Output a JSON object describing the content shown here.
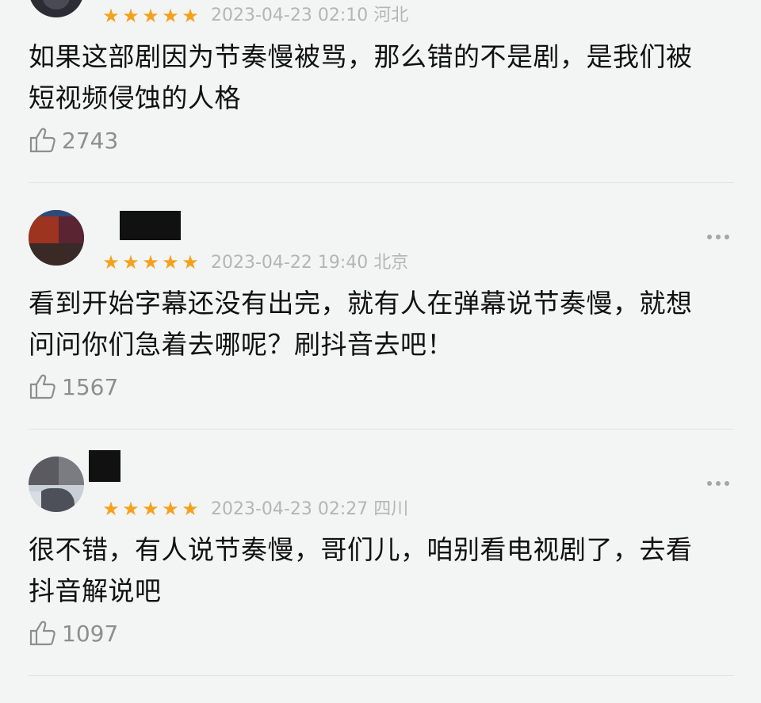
{
  "comments": [
    {
      "rating_icon": "star-icon",
      "stars": 5,
      "date": "2023-04-23 02:10",
      "location": "河北",
      "text_line1": "如果这部剧因为节奏慢被骂，那么错的不是剧，是我们被",
      "text_line2": "短视频侵蚀的人格",
      "likes": "2743"
    },
    {
      "stars": 5,
      "date": "2023-04-22 19:40",
      "location": "北京",
      "text_line1": "看到开始字幕还没有出完，就有人在弹幕说节奏慢，就想",
      "text_line2": "问问你们急着去哪呢？刷抖音去吧！",
      "likes": "1567"
    },
    {
      "stars": 5,
      "date": "2023-04-23 02:27",
      "location": "四川",
      "text_line1": "很不错，有人说节奏慢，哥们儿，咱别看电视剧了，去看",
      "text_line2": "抖音解说吧",
      "likes": "1097"
    }
  ],
  "colors": {
    "background": "#f3f4f4",
    "star": "#f4a21d",
    "meta": "#b5b5b5",
    "text": "#111111",
    "like": "#8e8e8e"
  },
  "icons": {
    "like": "thumbs-up-icon",
    "more": "more-dots-icon",
    "star": "star-icon"
  }
}
